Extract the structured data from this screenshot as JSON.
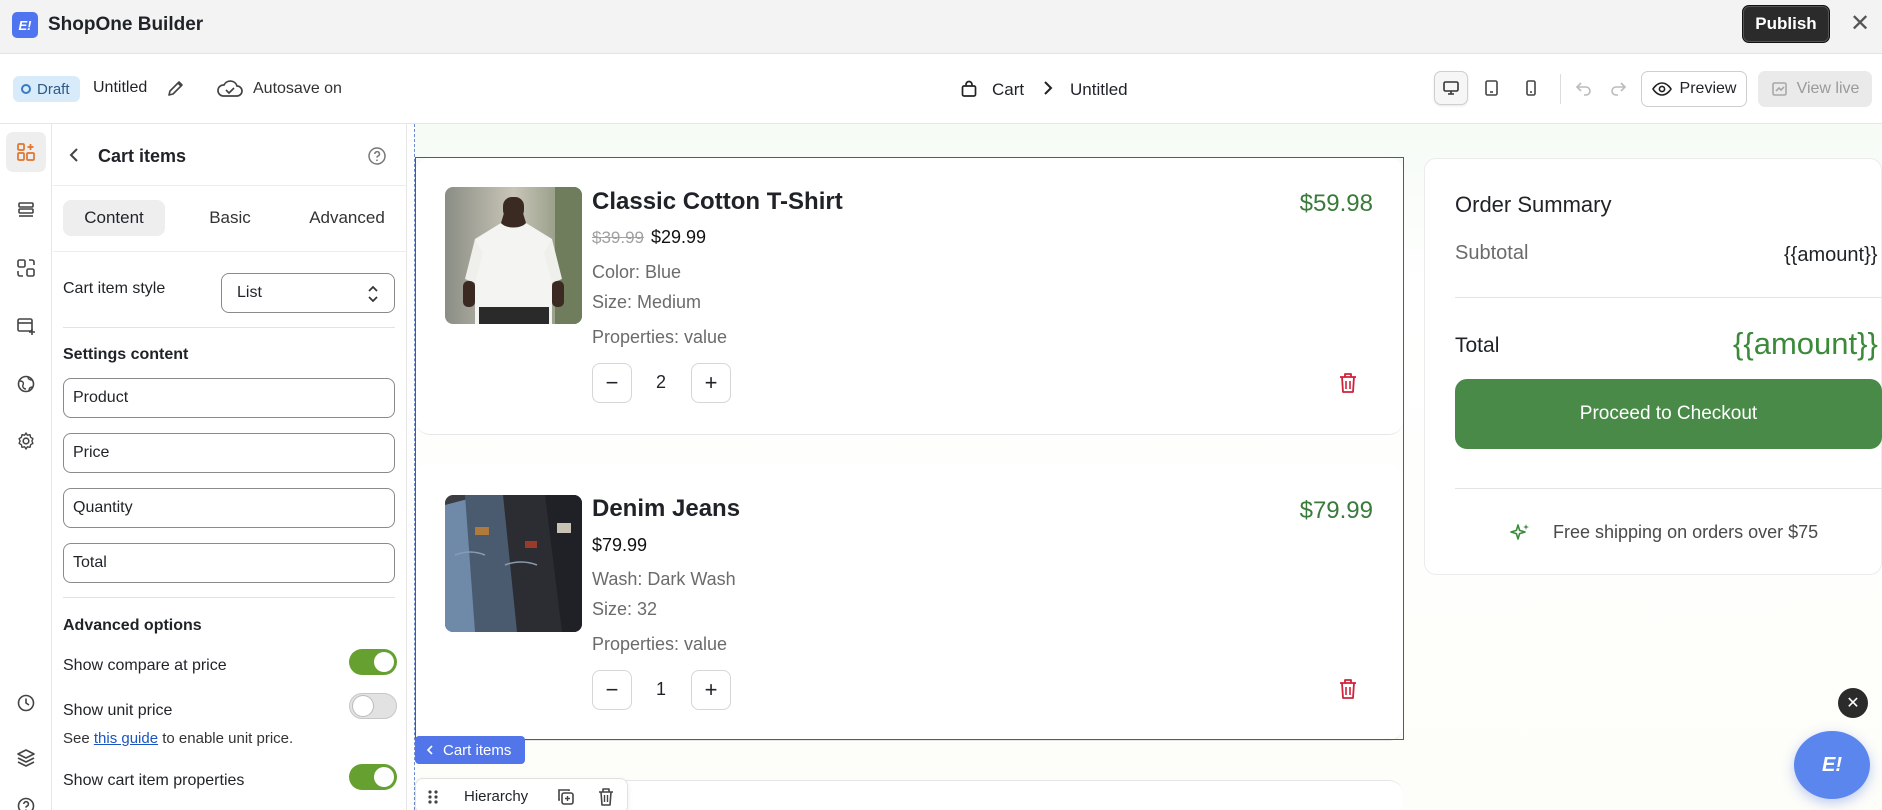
{
  "app": {
    "title": "ShopOne Builder",
    "logo_text": "E!",
    "publish_label": "Publish",
    "close_glyph": "✕"
  },
  "subbar": {
    "status": "Draft",
    "page_name": "Untitled",
    "autosave": "Autosave on",
    "breadcrumb": [
      "Cart",
      "Untitled"
    ],
    "preview_label": "Preview",
    "view_live_label": "View live",
    "devices": [
      "desktop-icon",
      "tablet-icon",
      "mobile-icon"
    ]
  },
  "rail": {
    "top_icons": [
      "elements-icon",
      "sections-icon",
      "templates-icon",
      "add-page-icon",
      "globe-icon",
      "gear-icon"
    ],
    "bottom_icons": [
      "history-icon",
      "layers-icon",
      "help-icon"
    ]
  },
  "panel": {
    "title": "Cart items",
    "tabs": [
      "Content",
      "Basic",
      "Advanced"
    ],
    "cart_item_style_label": "Cart item style",
    "cart_item_style_value": "List",
    "settings_content_title": "Settings content",
    "fields": [
      "Product",
      "Price",
      "Quantity",
      "Total"
    ],
    "advanced_title": "Advanced options",
    "options": [
      {
        "label": "Show compare at price",
        "on": true
      },
      {
        "label": "Show unit price",
        "on": false
      },
      {
        "label": "Show cart item properties",
        "on": true
      }
    ],
    "unit_note_prefix": "See ",
    "unit_note_link": "this guide",
    "unit_note_suffix": " to enable unit price."
  },
  "cart": {
    "items": [
      {
        "name": "Classic Cotton T-Shirt",
        "compare_price": "$39.99",
        "price": "$29.99",
        "variants": [
          "Color: Blue",
          "Size: Medium"
        ],
        "properties": "Properties: value",
        "quantity": "2",
        "line_total": "$59.98"
      },
      {
        "name": "Denim Jeans",
        "compare_price": "",
        "price": "$79.99",
        "variants": [
          "Wash: Dark Wash",
          "Size: 32"
        ],
        "properties": "Properties: value",
        "quantity": "1",
        "line_total": "$79.99"
      }
    ],
    "minus_glyph": "−",
    "plus_glyph": "+"
  },
  "summary": {
    "title": "Order Summary",
    "subtotal_label": "Subtotal",
    "subtotal_value": "{{amount}}",
    "total_label": "Total",
    "total_value": "{{amount}}",
    "checkout_label": "Proceed to Checkout",
    "shipping_note": "Free shipping on orders over $75"
  },
  "canvas": {
    "selected_tag": "Cart items",
    "hierarchy_label": "Hierarchy"
  },
  "colors": {
    "accent_green": "#4a8a48",
    "price_green": "#3a7a3a",
    "select_blue": "#3a52d6",
    "trash_red": "#d0223a"
  }
}
